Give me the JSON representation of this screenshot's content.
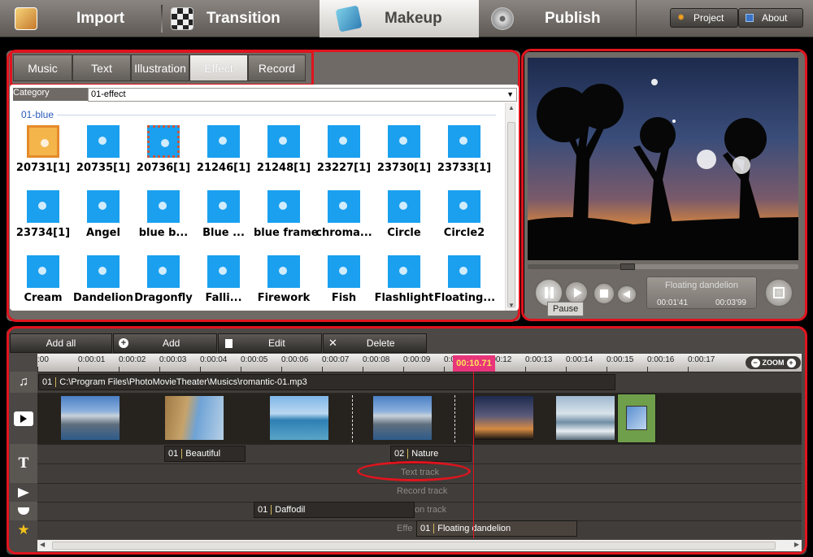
{
  "nav": {
    "tabs": [
      {
        "label": "Import"
      },
      {
        "label": "Transition"
      },
      {
        "label": "Makeup"
      },
      {
        "label": "Publish"
      }
    ],
    "project_label": "Project",
    "about_label": "About"
  },
  "resources": {
    "tabs": [
      {
        "label": "Music"
      },
      {
        "label": "Text"
      },
      {
        "label": "Illustration"
      },
      {
        "label": "Effect"
      },
      {
        "label": "Record"
      }
    ],
    "category_label": "Category",
    "category_value": "01-effect",
    "group_title": "01-blue",
    "items": [
      {
        "label": "20731[1]"
      },
      {
        "label": "20735[1]"
      },
      {
        "label": "20736[1]"
      },
      {
        "label": "21246[1]"
      },
      {
        "label": "21248[1]"
      },
      {
        "label": "23227[1]"
      },
      {
        "label": "23730[1]"
      },
      {
        "label": "23733[1]"
      },
      {
        "label": "23734[1]"
      },
      {
        "label": "Angel"
      },
      {
        "label": "blue b..."
      },
      {
        "label": "Blue ..."
      },
      {
        "label": "blue frame"
      },
      {
        "label": "chroma..."
      },
      {
        "label": "Circle"
      },
      {
        "label": "Circle2"
      },
      {
        "label": "Cream"
      },
      {
        "label": "Dandelion"
      },
      {
        "label": "Dragonfly"
      },
      {
        "label": "Falli..."
      },
      {
        "label": "Firework"
      },
      {
        "label": "Fish"
      },
      {
        "label": "Flashlight"
      },
      {
        "label": "Floating..."
      }
    ]
  },
  "preview": {
    "effect_name": "Floating dandelion",
    "current_time": "00:01'41",
    "total_time": "00:03'99",
    "tooltip": "Pause",
    "progress": 0.37
  },
  "timeline": {
    "buttons": {
      "add_all": "Add all",
      "add": "Add",
      "edit": "Edit",
      "delete": "Delete"
    },
    "ticks": [
      ":00",
      "0:00:01",
      "0:00:02",
      "0:00:03",
      "0:00:04",
      "0:00:05",
      "0:00:06",
      "0:00:07",
      "0:00:08",
      "0:00:09",
      "0:00:1",
      "0:00:12",
      "0:00:13",
      "0:00:14",
      "0:00:15",
      "0:00:16",
      "0:00:17"
    ],
    "playhead": "00:10.71",
    "zoom_label": "ZOOM",
    "music_clip": {
      "num": "01",
      "name": "C:\\Program Files\\PhotoMovieTheater\\Musics\\romantic-01.mp3"
    },
    "text_clips": [
      {
        "num": "01",
        "name": "Beautiful"
      },
      {
        "num": "02",
        "name": "Nature"
      }
    ],
    "text_track_label": "Text track",
    "record_track_label": "Record track",
    "illustration_clip": {
      "num": "01",
      "name": "Daffodil"
    },
    "illustration_track_label": "on track",
    "effect_track_label": "Effe",
    "effect_clip": {
      "num": "01",
      "name": "Floating dandelion"
    }
  }
}
